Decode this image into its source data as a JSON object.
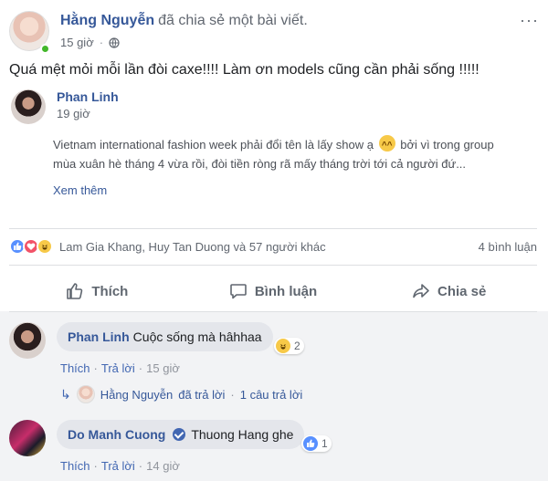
{
  "post": {
    "author": "Hằng Nguyễn",
    "action": "đã chia sẻ một bài viết.",
    "time": "15 giờ",
    "status": "Quá mệt mỏi mỗi lần đòi caxe!!!! Làm ơn models cũng cần phải sống !!!!!"
  },
  "shared": {
    "author": "Phan Linh",
    "time": "19 giờ",
    "line1_a": "Vietnam international fashion week phải đổi tên là lấy show ạ",
    "line1_b": "bởi vì trong group",
    "line2": "mùa xuân hè tháng 4 vừa rồi, đòi tiền ròng rã mấy tháng trời tới cả người đứ...",
    "see_more": "Xem thêm"
  },
  "reactions": {
    "names": "Lam Gia Khang, Huy Tan Duong và 57 người khác",
    "comment_count": "4 bình luận",
    "icons": [
      "like",
      "love",
      "haha"
    ]
  },
  "actions": {
    "like": "Thích",
    "comment": "Bình luận",
    "share": "Chia sẻ"
  },
  "comments": [
    {
      "author": "Phan Linh",
      "text": "Cuộc sống mà hâhhaa",
      "reaction_count": "2",
      "like": "Thích",
      "reply": "Trả lời",
      "time": "15 giờ"
    },
    {
      "author": "Do Manh Cuong",
      "text": "Thuong Hang ghe",
      "reaction_count": "1",
      "like": "Thích",
      "reply": "Trả lời",
      "time": "14 giờ"
    }
  ],
  "reply_summary": {
    "author": "Hằng Nguyễn",
    "text": "đã trả lời",
    "count": "1 câu trả lời"
  },
  "colors": {
    "link": "#365899",
    "like": "#5890ff",
    "love": "#f25268",
    "haha": "#f7c948",
    "online": "#42b72a"
  }
}
